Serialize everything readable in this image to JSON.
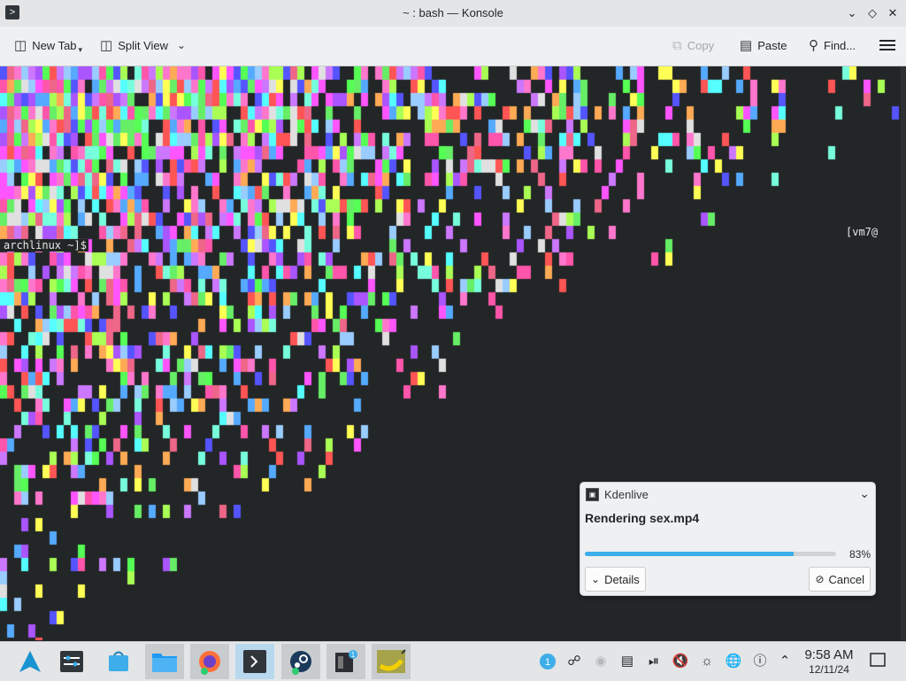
{
  "window": {
    "title": "~ : bash — Konsole",
    "minimize_icon": "chevron-down",
    "maximize_icon": "diamond",
    "close_icon": "close"
  },
  "toolbar": {
    "new_tab": "New Tab",
    "split_view": "Split View",
    "copy": "Copy",
    "paste": "Paste",
    "find": "Find..."
  },
  "terminal": {
    "prompt_left": "archlinux ~]$",
    "prompt_right": "[vm7@",
    "background": "#232627"
  },
  "notification": {
    "app": "Kdenlive",
    "title": "Rendering sex.mp4",
    "progress_percent": 83,
    "progress_label": "83%",
    "details_label": "Details",
    "cancel_label": "Cancel",
    "accent": "#3daee9"
  },
  "taskbar": {
    "time": "9:58 AM",
    "date": "12/11/24",
    "tray_badge": "1",
    "discover_badge": "1"
  }
}
